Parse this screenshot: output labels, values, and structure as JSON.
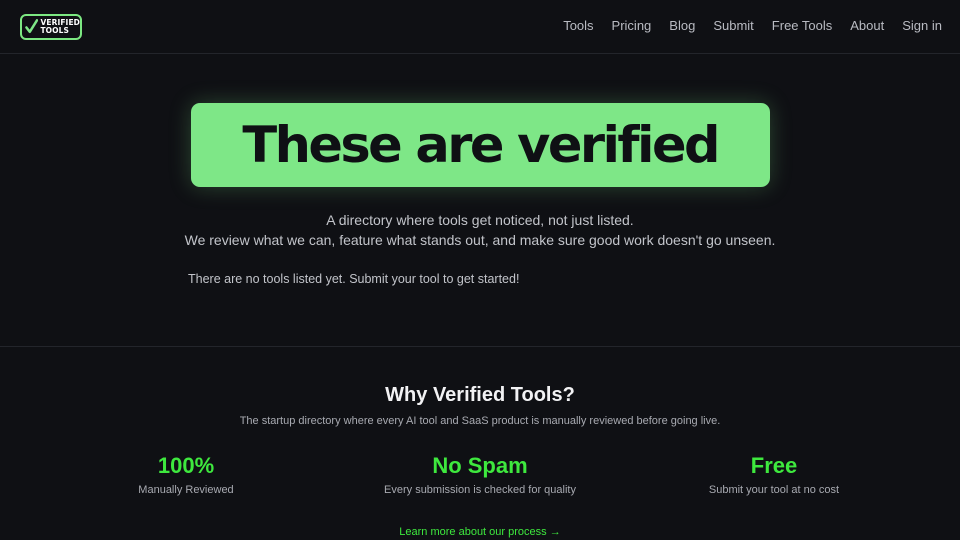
{
  "brand": {
    "logo_line1": "VERIFIED",
    "logo_line2": "TOOLS",
    "accent_color": "#7ee787"
  },
  "nav": {
    "items": [
      {
        "label": "Tools"
      },
      {
        "label": "Pricing"
      },
      {
        "label": "Blog"
      },
      {
        "label": "Submit"
      },
      {
        "label": "Free Tools"
      },
      {
        "label": "About"
      },
      {
        "label": "Sign in"
      }
    ]
  },
  "hero": {
    "title": "These are verified",
    "subtitle_line1": "A directory where tools get noticed, not just listed.",
    "subtitle_line2": "We review what we can, feature what stands out, and make sure good work doesn't go unseen.",
    "empty_note": "There are no tools listed yet. Submit your tool to get started!"
  },
  "why": {
    "title": "Why Verified Tools?",
    "subtitle": "The startup directory where every AI tool and SaaS product is manually reviewed before going live.",
    "stats": [
      {
        "value": "100%",
        "label": "Manually Reviewed"
      },
      {
        "value": "No Spam",
        "label": "Every submission is checked for quality"
      },
      {
        "value": "Free",
        "label": "Submit your tool at no cost"
      }
    ],
    "learn_more": "Learn more about our process →",
    "stat_color": "#3ee83e"
  }
}
